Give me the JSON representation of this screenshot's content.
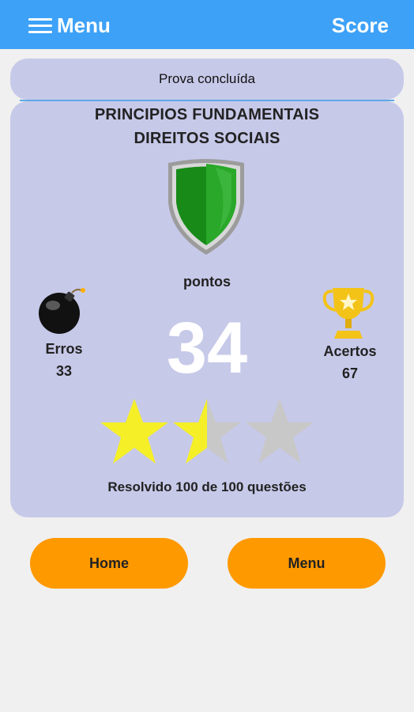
{
  "appbar": {
    "menu_label": "Menu",
    "score_label": "Score",
    "background": "#3da1f7"
  },
  "status": {
    "text": "Prova concluída"
  },
  "result": {
    "title_line1": "PRINCIPIOS FUNDAMENTAIS",
    "title_line2": "DIREITOS SOCIAIS",
    "points_label": "pontos",
    "score": "34",
    "errors_label": "Erros",
    "errors_value": "33",
    "hits_label": "Acertos",
    "hits_value": "67",
    "stars_total": 3,
    "stars_filled": 1.5,
    "solved_text": "Resolvido 100 de 100 questões",
    "shield_color": "#1e8a1e",
    "star_color": "#f5ef28",
    "star_empty_color": "#c8c8c8"
  },
  "buttons": {
    "home_label": "Home",
    "menu_label": "Menu",
    "color": "#ff9900"
  },
  "icons": {
    "menu": "hamburger-icon",
    "shield": "shield-icon",
    "bomb": "bomb-icon",
    "trophy": "trophy-icon",
    "star": "star-icon"
  }
}
